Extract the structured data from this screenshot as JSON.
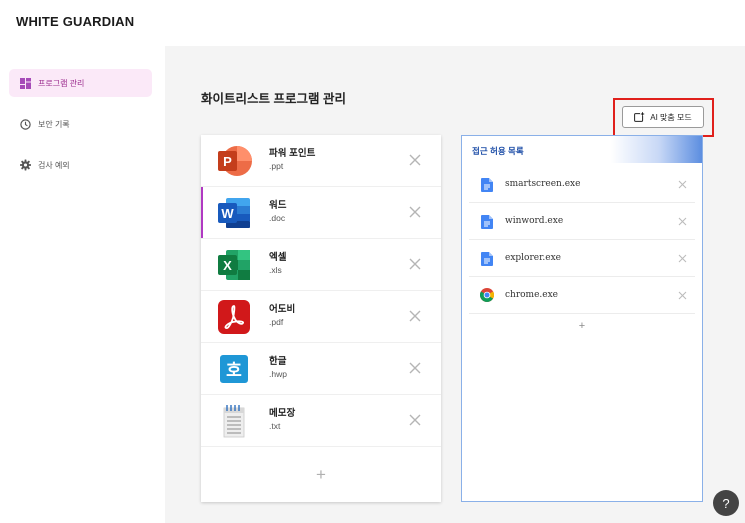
{
  "brand": "WHITE GUARDIAN",
  "sidebar": {
    "items": [
      {
        "label": "프로그램 관리",
        "icon": "dashboard-icon",
        "active": true
      },
      {
        "label": "보안 기록",
        "icon": "clock-icon",
        "active": false
      },
      {
        "label": "검사 예외",
        "icon": "gear-icon",
        "active": false
      }
    ]
  },
  "main": {
    "title": "화이트리스트 프로그램 관리",
    "ai_button": {
      "label": "AI 맞춤 모드",
      "icon": "add-window-icon"
    }
  },
  "programs": [
    {
      "name": "파워 포인트",
      "ext": ".ppt",
      "icon": "powerpoint-icon"
    },
    {
      "name": "워드",
      "ext": ".doc",
      "icon": "word-icon"
    },
    {
      "name": "엑셀",
      "ext": ".xls",
      "icon": "excel-icon"
    },
    {
      "name": "어도비",
      "ext": ".pdf",
      "icon": "acrobat-icon"
    },
    {
      "name": "한글",
      "ext": ".hwp",
      "icon": "hangul-icon"
    },
    {
      "name": "메모장",
      "ext": ".txt",
      "icon": "notepad-icon"
    }
  ],
  "programs_add": "+",
  "allow_list": {
    "title": "접근 허용 목록",
    "items": [
      {
        "name": "smartscreen.exe",
        "icon": "file-icon"
      },
      {
        "name": "winword.exe",
        "icon": "file-icon"
      },
      {
        "name": "explorer.exe",
        "icon": "file-icon"
      },
      {
        "name": "chrome.exe",
        "icon": "chrome-icon"
      }
    ],
    "add": "+"
  },
  "help_label": "?",
  "colors": {
    "accent": "#b039c2",
    "active_nav_bg": "#fbe9f8",
    "panel_title": "#1f4fa8",
    "highlight_box": "#e0201b"
  }
}
